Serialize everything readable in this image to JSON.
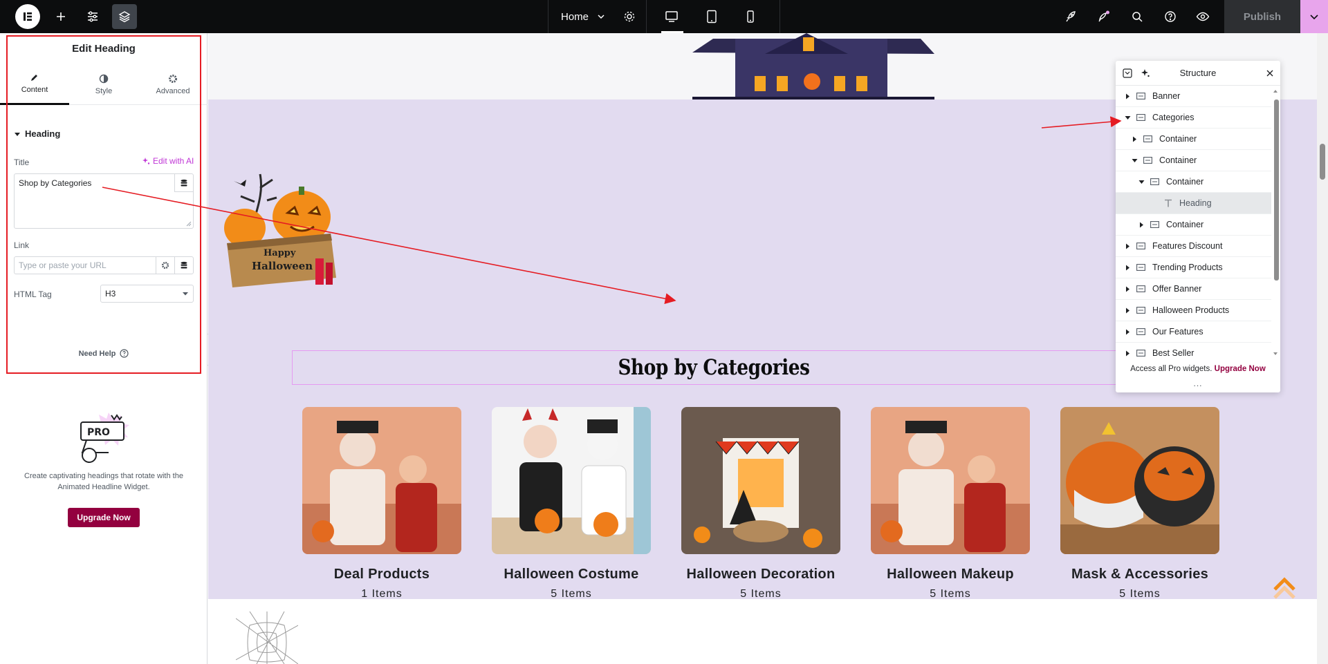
{
  "topbar": {
    "page_name": "Home",
    "publish_label": "Publish"
  },
  "panel": {
    "title": "Edit Heading",
    "tabs": [
      {
        "label": "Content"
      },
      {
        "label": "Style"
      },
      {
        "label": "Advanced"
      }
    ],
    "section_heading": "Heading",
    "title_label": "Title",
    "edit_ai_label": "Edit with AI",
    "title_value": "Shop by Categories",
    "link_label": "Link",
    "link_placeholder": "Type or paste your URL",
    "html_tag_label": "HTML Tag",
    "html_tag_value": "H3",
    "need_help": "Need Help",
    "pro_badge": "PRO",
    "pro_text": "Create captivating headings that rotate with the Animated Headline Widget.",
    "upgrade_label": "Upgrade Now"
  },
  "canvas": {
    "sign_text": [
      "Happy",
      "Halloween"
    ],
    "heading": "Shop by Categories",
    "cards": [
      {
        "name": "Deal Products",
        "count": "1  Items"
      },
      {
        "name": "Halloween Costume",
        "count": "5  Items"
      },
      {
        "name": "Halloween Decoration",
        "count": "5  Items"
      },
      {
        "name": "Halloween Makeup",
        "count": "5  Items"
      },
      {
        "name": "Mask & Accessories",
        "count": "5  Items"
      }
    ]
  },
  "structure": {
    "title": "Structure",
    "items": [
      {
        "label": "Banner",
        "depth": 0,
        "expanded": false
      },
      {
        "label": "Categories",
        "depth": 0,
        "expanded": true
      },
      {
        "label": "Container",
        "depth": 1,
        "expanded": false
      },
      {
        "label": "Container",
        "depth": 1,
        "expanded": true
      },
      {
        "label": "Container",
        "depth": 2,
        "expanded": true
      },
      {
        "label": "Heading",
        "depth": 3,
        "selected": true
      },
      {
        "label": "Container",
        "depth": 2,
        "expanded": false
      },
      {
        "label": "Features Discount",
        "depth": 0,
        "expanded": false
      },
      {
        "label": "Trending Products",
        "depth": 0,
        "expanded": false
      },
      {
        "label": "Offer Banner",
        "depth": 0,
        "expanded": false
      },
      {
        "label": "Halloween Products",
        "depth": 0,
        "expanded": false
      },
      {
        "label": "Our Features",
        "depth": 0,
        "expanded": false
      },
      {
        "label": "Best Seller",
        "depth": 0,
        "expanded": false
      }
    ],
    "footer_text": "Access all Pro widgets.",
    "footer_link": "Upgrade Now",
    "footer_dots": "..."
  },
  "colors": {
    "accent_pink": "#c036d6",
    "upgrade_bg": "#93003f",
    "annotation_red": "#e51c23",
    "section_bg": "#e2dbf0"
  }
}
